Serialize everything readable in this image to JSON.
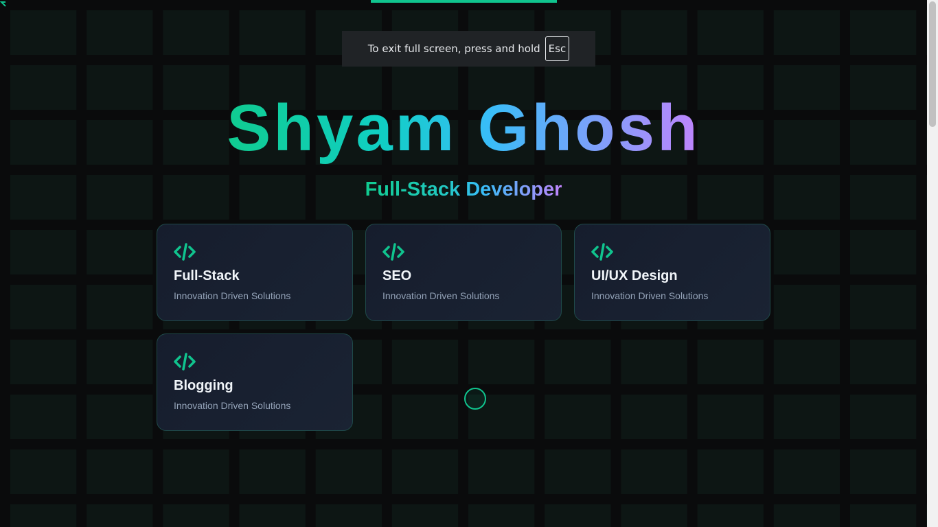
{
  "fullscreen_notice": {
    "text": "To exit full screen, press and hold",
    "key": "Esc"
  },
  "hero": {
    "name": "Shyam Ghosh",
    "role": "Full-Stack Developer"
  },
  "cards": [
    {
      "icon": "code-icon",
      "title": "Full-Stack",
      "subtitle": "Innovation Driven Solutions"
    },
    {
      "icon": "code-icon",
      "title": "SEO",
      "subtitle": "Innovation Driven Solutions"
    },
    {
      "icon": "code-icon",
      "title": "UI/UX Design",
      "subtitle": "Innovation Driven Solutions"
    },
    {
      "icon": "code-icon",
      "title": "Blogging",
      "subtitle": "Innovation Driven Solutions"
    }
  ],
  "colors": {
    "accent": "#10c48e",
    "gradient_start": "#10cc90",
    "gradient_mid": "#38bdf8",
    "gradient_end": "#c084fc",
    "background": "#0a0b0c",
    "card_background": "#161d2d"
  }
}
